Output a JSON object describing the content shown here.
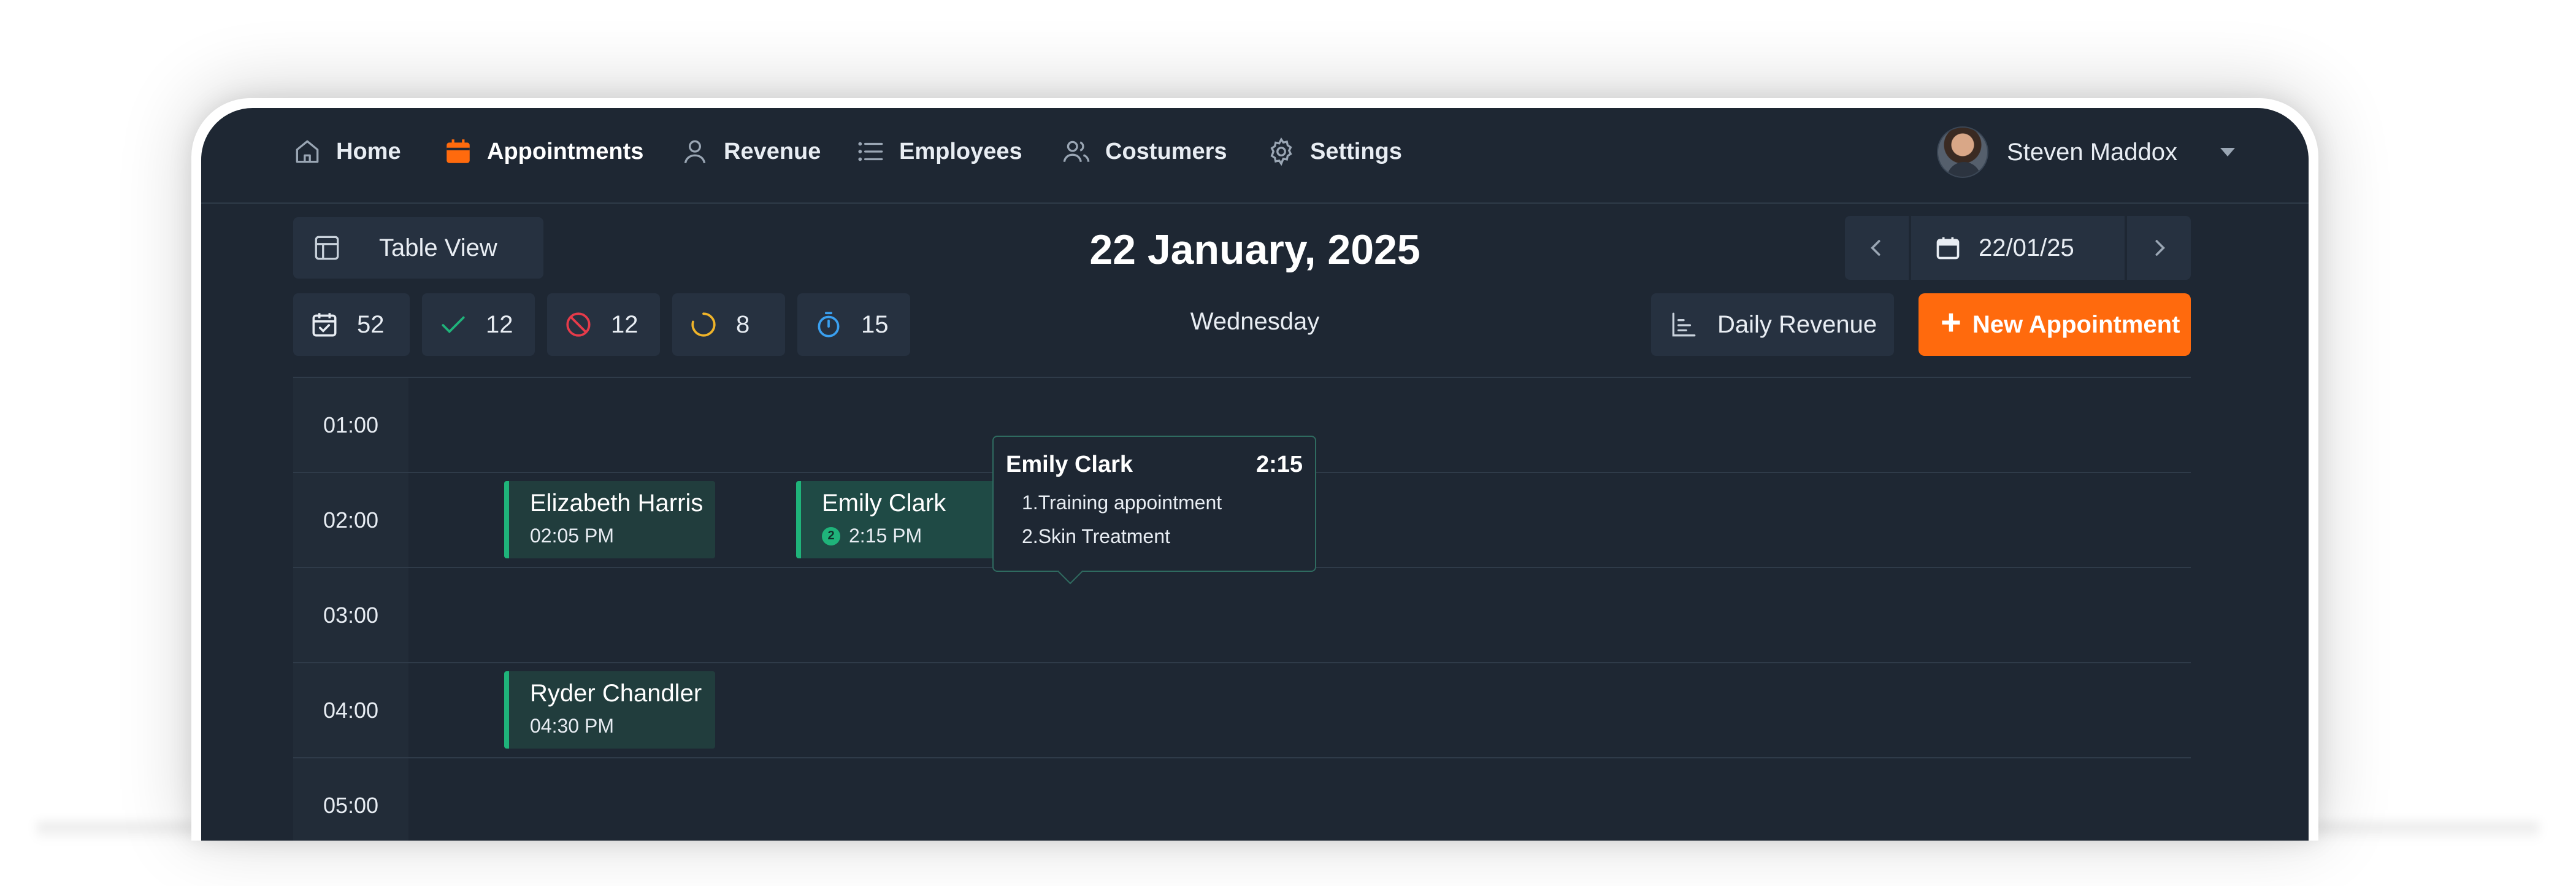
{
  "nav": {
    "items": [
      {
        "label": "Home",
        "icon": "home-icon"
      },
      {
        "label": "Appointments",
        "icon": "calendar-icon",
        "active": true
      },
      {
        "label": "Revenue",
        "icon": "user-icon"
      },
      {
        "label": "Employees",
        "icon": "list-icon"
      },
      {
        "label": "Costumers",
        "icon": "users-icon"
      },
      {
        "label": "Settings",
        "icon": "gear-icon"
      }
    ],
    "user_name": "Steven Maddox"
  },
  "toolbar": {
    "view_label": "Table View",
    "title_date": "22 January, 2025",
    "weekday": "Wednesday",
    "date_value": "22/01/25",
    "daily_revenue_label": "Daily Revenue",
    "new_appointment_label": "New Appointment"
  },
  "stats": [
    {
      "icon": "calendar-check-icon",
      "value": "52",
      "color": "#e8edf3"
    },
    {
      "icon": "check-icon",
      "value": "12",
      "color": "#1fb37a"
    },
    {
      "icon": "cancel-icon",
      "value": "12",
      "color": "#e63b4a"
    },
    {
      "icon": "progress-icon",
      "value": "8",
      "color": "#f0b429"
    },
    {
      "icon": "timer-icon",
      "value": "15",
      "color": "#3aa0f0"
    }
  ],
  "schedule": {
    "hours": [
      "01:00",
      "02:00",
      "03:00",
      "04:00",
      "05:00"
    ],
    "appointments": [
      {
        "name": "Elizabeth Harris",
        "time": "02:05 PM"
      },
      {
        "name": "Emily Clark",
        "time": "2:15 PM",
        "badge": "2"
      },
      {
        "name": "Ryder Chandler",
        "time": "04:30 PM"
      }
    ]
  },
  "tooltip": {
    "name": "Emily Clark",
    "duration": "2:15",
    "services": [
      "1.Training appointment",
      "2.Skin Treatment"
    ]
  },
  "colors": {
    "accent": "#ff6a0d",
    "confirmed": "#1fb37a",
    "now_line": "#e63b4a",
    "background": "#1e2733"
  }
}
